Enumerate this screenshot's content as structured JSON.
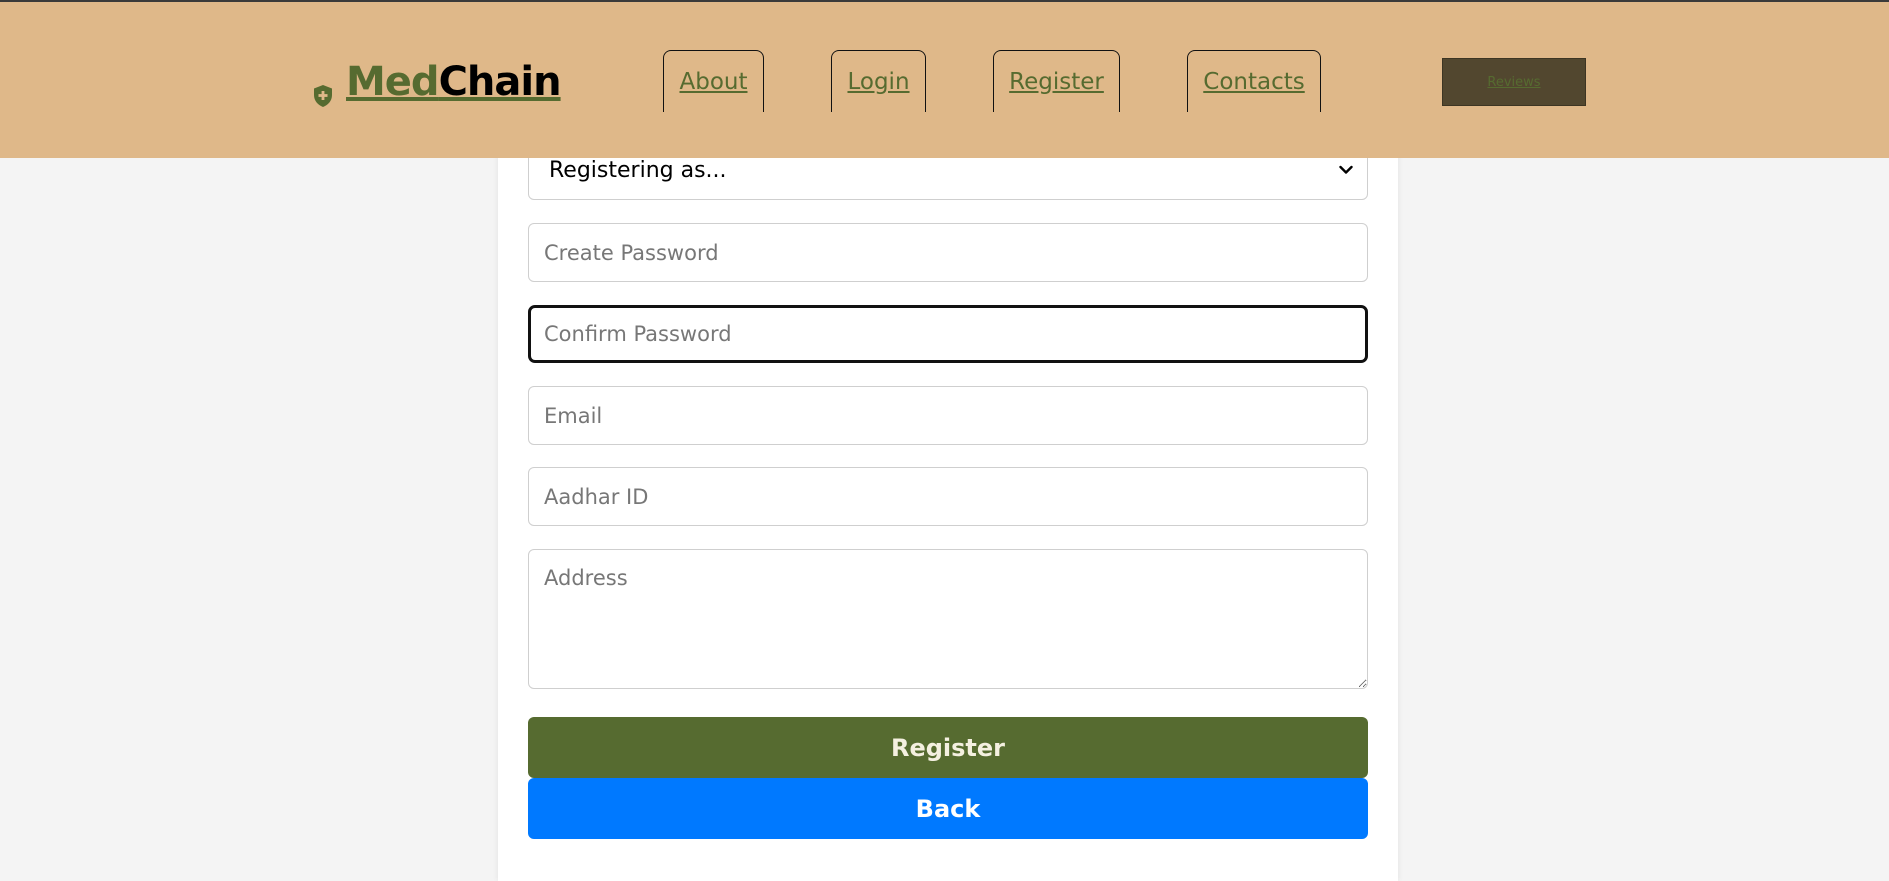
{
  "header": {
    "logo": {
      "icon": "shield-plus-icon",
      "part1": "Med",
      "part2": "Chain"
    },
    "nav": {
      "about": "About",
      "login": "Login",
      "register": "Register",
      "contacts": "Contacts"
    },
    "reviews_label": "Reviews"
  },
  "form": {
    "role_select": {
      "selected": "Registering as...",
      "icon": "chevron-down-icon"
    },
    "create_password_placeholder": "Create Password",
    "confirm_password_placeholder": "Confirm Password",
    "email_placeholder": "Email",
    "aadhar_placeholder": "Aadhar ID",
    "address_placeholder": "Address",
    "register_button": "Register",
    "back_button": "Back"
  },
  "colors": {
    "header_bg": "#dfb889",
    "brand_green": "#566b30",
    "back_blue": "#0079ff",
    "reviews_bg": "#52472f",
    "page_bg": "#f4f4f4"
  }
}
